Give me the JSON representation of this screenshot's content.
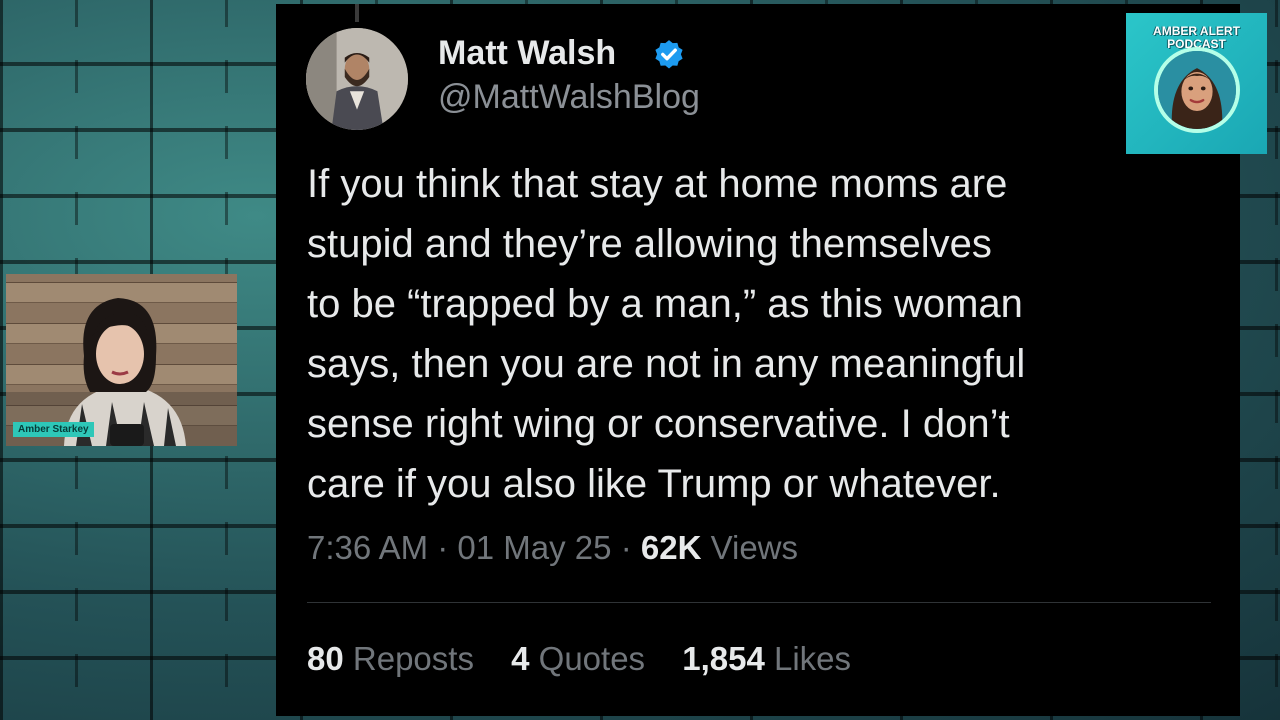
{
  "tweet": {
    "author_name": "Matt Walsh",
    "verified_icon": "verified-badge-icon",
    "author_handle": "@MattWalshBlog",
    "text_lines": [
      "If you think that stay at home moms are",
      "stupid and they’re allowing themselves",
      "to be “trapped by a man,” as this woman",
      "says, then you are not in any meaningful",
      "sense right wing or conservative. I don’t",
      "care if you also like Trump or whatever."
    ],
    "time": "7:36 AM",
    "separator": "·",
    "date": "01 May 25",
    "views_count": "62K",
    "views_label": "Views",
    "stats": {
      "reposts_count": "80",
      "reposts_label": "Reposts",
      "quotes_count": "4",
      "quotes_label": "Quotes",
      "likes_count": "1,854",
      "likes_label": "Likes"
    }
  },
  "podcast_logo": {
    "line1": "AMBER ALERT",
    "line2": "PODCAST"
  },
  "webcam": {
    "name_label": "Amber Starkey"
  },
  "colors": {
    "card_bg": "#000000",
    "text_primary": "#e7e9ea",
    "text_secondary": "#71767b",
    "verified_blue": "#1d9bf0",
    "logo_teal": "#2bc6c9"
  }
}
